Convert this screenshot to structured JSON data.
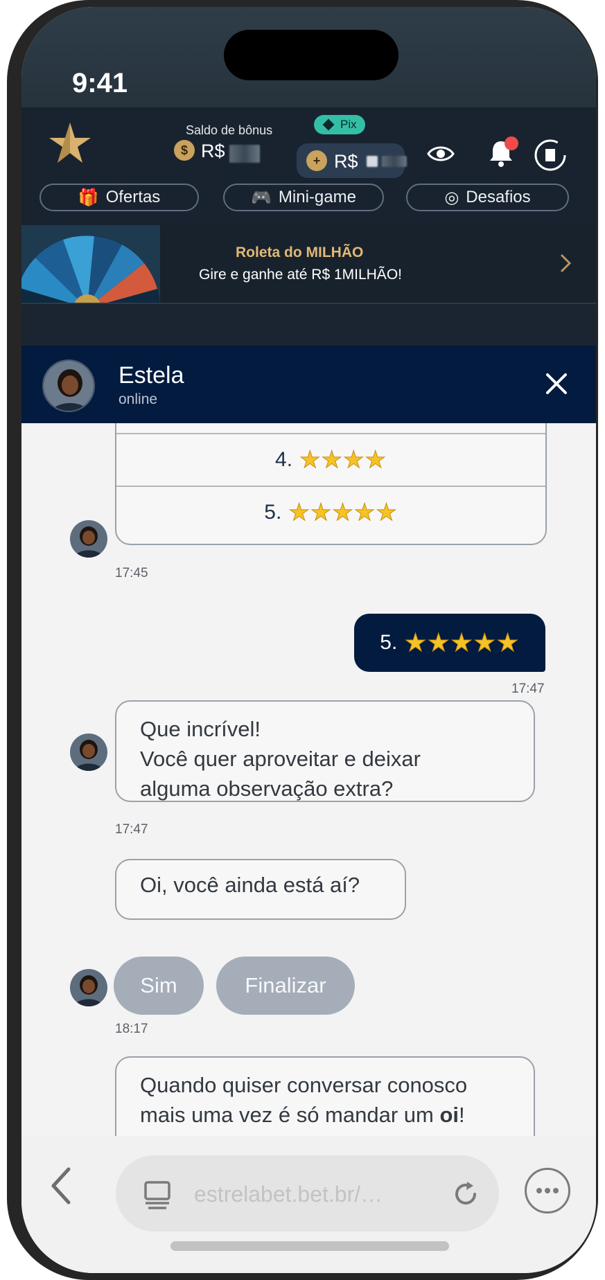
{
  "status_bar": {
    "time": "9:41"
  },
  "header": {
    "bonus_label": "Saldo de bônus",
    "bonus_currency": "R$",
    "pix_label": "Pix",
    "balance_currency": "R$",
    "nav": [
      {
        "label": "Ofertas",
        "icon": "gift-icon"
      },
      {
        "label": "Mini-game",
        "icon": "gamepad-icon"
      },
      {
        "label": "Desafios",
        "icon": "target-icon"
      }
    ]
  },
  "banner": {
    "title": "Roleta do MILHÃO",
    "subtitle": "Gire e ganhe até R$ 1MILHÃO!"
  },
  "chat_header": {
    "agent_name": "Estela",
    "agent_status": "online"
  },
  "messages": {
    "rating_options": [
      {
        "label": "4.",
        "stars": 4
      },
      {
        "label": "5.",
        "stars": 5
      }
    ],
    "rating_time": "17:45",
    "user_reply": {
      "label": "5.",
      "stars": 5,
      "time": "17:47"
    },
    "bot_question": {
      "lines": [
        "Que incrível!",
        "Você quer aproveitar e deixar",
        "alguma observação extra?"
      ],
      "time": "17:47"
    },
    "bot_followup": "Oi, você ainda está aí?",
    "quick_replies": [
      "Sim",
      "Finalizar"
    ],
    "quick_time": "18:17",
    "bot_goodbye": {
      "line1": "Quando quiser conversar conosco",
      "line2_prefix": "mais uma vez é só mandar um ",
      "line2_bold": "oi",
      "line2_suffix": "!"
    }
  },
  "browser": {
    "url": "estrelabet.bet.br/…"
  },
  "colors": {
    "chat_header": "#021b3f",
    "app_header": "#19232f",
    "accent_gold": "#e2b876",
    "pix_green": "#33bfa6",
    "quick_reply": "#a4adb8"
  }
}
